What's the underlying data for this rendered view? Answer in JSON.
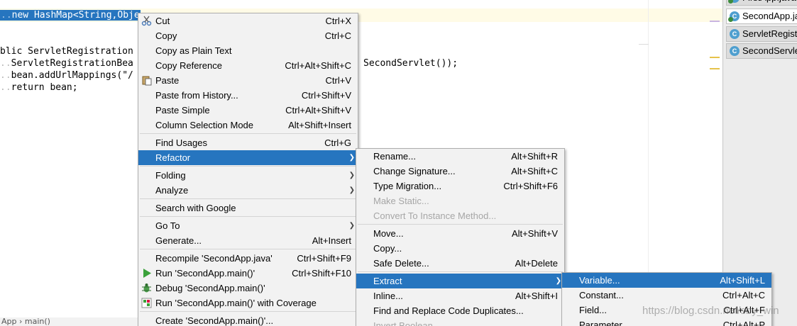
{
  "editor": {
    "code_line_1": "new HashMap<String,Obje",
    "code_line_2": "blic ServletRegistration",
    "code_line_3": "ServletRegistrationBea",
    "code_line_3_tail": "SecondServlet());",
    "code_line_4": "bean.addUrlMappings(\"/",
    "code_line_5_kw": "return",
    "code_line_5_rest": " bean;",
    "breadcrumb": "App  ›  main()"
  },
  "tabs": [
    {
      "label": "FirstApp.java",
      "active": false
    },
    {
      "label": "SecondApp.java",
      "active": true
    },
    {
      "label": "ServletRegistration",
      "active": false
    },
    {
      "label": "SecondServlet",
      "active": false
    }
  ],
  "context_menu": [
    {
      "label": "Cut",
      "mnemonic": "t",
      "shortcut": "Ctrl+X",
      "icon": "scissors-icon"
    },
    {
      "label": "Copy",
      "mnemonic": "C",
      "shortcut": "Ctrl+C",
      "icon": ""
    },
    {
      "label": "Copy as Plain Text",
      "mnemonic": "",
      "shortcut": "",
      "icon": ""
    },
    {
      "label": "Copy Reference",
      "mnemonic": "y",
      "shortcut": "Ctrl+Alt+Shift+C",
      "icon": ""
    },
    {
      "label": "Paste",
      "mnemonic": "P",
      "shortcut": "Ctrl+V",
      "icon": "paste-icon"
    },
    {
      "label": "Paste from History...",
      "mnemonic": "e",
      "shortcut": "Ctrl+Shift+V",
      "icon": ""
    },
    {
      "label": "Paste Simple",
      "mnemonic": "i",
      "shortcut": "Ctrl+Alt+Shift+V",
      "icon": ""
    },
    {
      "label": "Column Selection Mode",
      "mnemonic": "M",
      "shortcut": "Alt+Shift+Insert",
      "icon": ""
    },
    {
      "sep": true
    },
    {
      "label": "Find Usages",
      "mnemonic": "U",
      "shortcut": "Ctrl+G",
      "icon": ""
    },
    {
      "label": "Refactor",
      "mnemonic": "R",
      "shortcut": "",
      "submenu": true,
      "highlighted": true
    },
    {
      "sep": true
    },
    {
      "label": "Folding",
      "mnemonic": "",
      "shortcut": "",
      "submenu": true
    },
    {
      "label": "Analyze",
      "mnemonic": "",
      "shortcut": "",
      "submenu": true
    },
    {
      "sep": true
    },
    {
      "label": "Search with Google",
      "mnemonic": "",
      "shortcut": ""
    },
    {
      "sep": true
    },
    {
      "label": "Go To",
      "mnemonic": "",
      "shortcut": "",
      "submenu": true
    },
    {
      "label": "Generate...",
      "mnemonic": "",
      "shortcut": "Alt+Insert"
    },
    {
      "sep": true
    },
    {
      "label": "Recompile 'SecondApp.java'",
      "mnemonic": "",
      "shortcut": "Ctrl+Shift+F9"
    },
    {
      "label": "Run 'SecondApp.main()'",
      "mnemonic": "",
      "shortcut": "Ctrl+Shift+F10",
      "icon": "run-icon"
    },
    {
      "label": "Debug 'SecondApp.main()'",
      "mnemonic": "",
      "shortcut": "",
      "icon": "debug-icon"
    },
    {
      "label": "Run 'SecondApp.main()' with Coverage",
      "mnemonic": "",
      "shortcut": "",
      "icon": "coverage-icon"
    },
    {
      "sep": true
    },
    {
      "label": "Create 'SecondApp.main()'...",
      "mnemonic": "",
      "shortcut": "",
      "icon": ""
    }
  ],
  "refactor_menu": [
    {
      "label": "Rename...",
      "shortcut": "Alt+Shift+R"
    },
    {
      "label": "Change Signature...",
      "shortcut": "Alt+Shift+C"
    },
    {
      "label": "Type Migration...",
      "shortcut": "Ctrl+Shift+F6"
    },
    {
      "label": "Make Static...",
      "shortcut": "",
      "disabled": true
    },
    {
      "label": "Convert To Instance Method...",
      "shortcut": "",
      "disabled": true
    },
    {
      "sep": true
    },
    {
      "label": "Move...",
      "shortcut": "Alt+Shift+V"
    },
    {
      "label": "Copy...",
      "shortcut": ""
    },
    {
      "label": "Safe Delete...",
      "shortcut": "Alt+Delete"
    },
    {
      "sep": true
    },
    {
      "label": "Extract",
      "shortcut": "",
      "submenu": true,
      "highlighted": true
    },
    {
      "label": "Inline...",
      "shortcut": "Alt+Shift+I"
    },
    {
      "label": "Find and Replace Code Duplicates...",
      "shortcut": ""
    },
    {
      "label": "Invert Boolean...",
      "shortcut": "",
      "disabled": true
    }
  ],
  "extract_menu": [
    {
      "label": "Variable...",
      "shortcut": "Alt+Shift+L",
      "highlighted": true
    },
    {
      "label": "Constant...",
      "shortcut": "Ctrl+Alt+C"
    },
    {
      "label": "Field...",
      "shortcut": "Ctrl+Alt+F"
    },
    {
      "label": "Parameter...",
      "shortcut": "Ctrl+Alt+P"
    }
  ],
  "watermark": "https://blog.csdn.net/sby_win",
  "colors": {
    "highlight": "#2675bf",
    "menu_bg": "#f2f2f2",
    "disabled": "#a6a6a6"
  }
}
